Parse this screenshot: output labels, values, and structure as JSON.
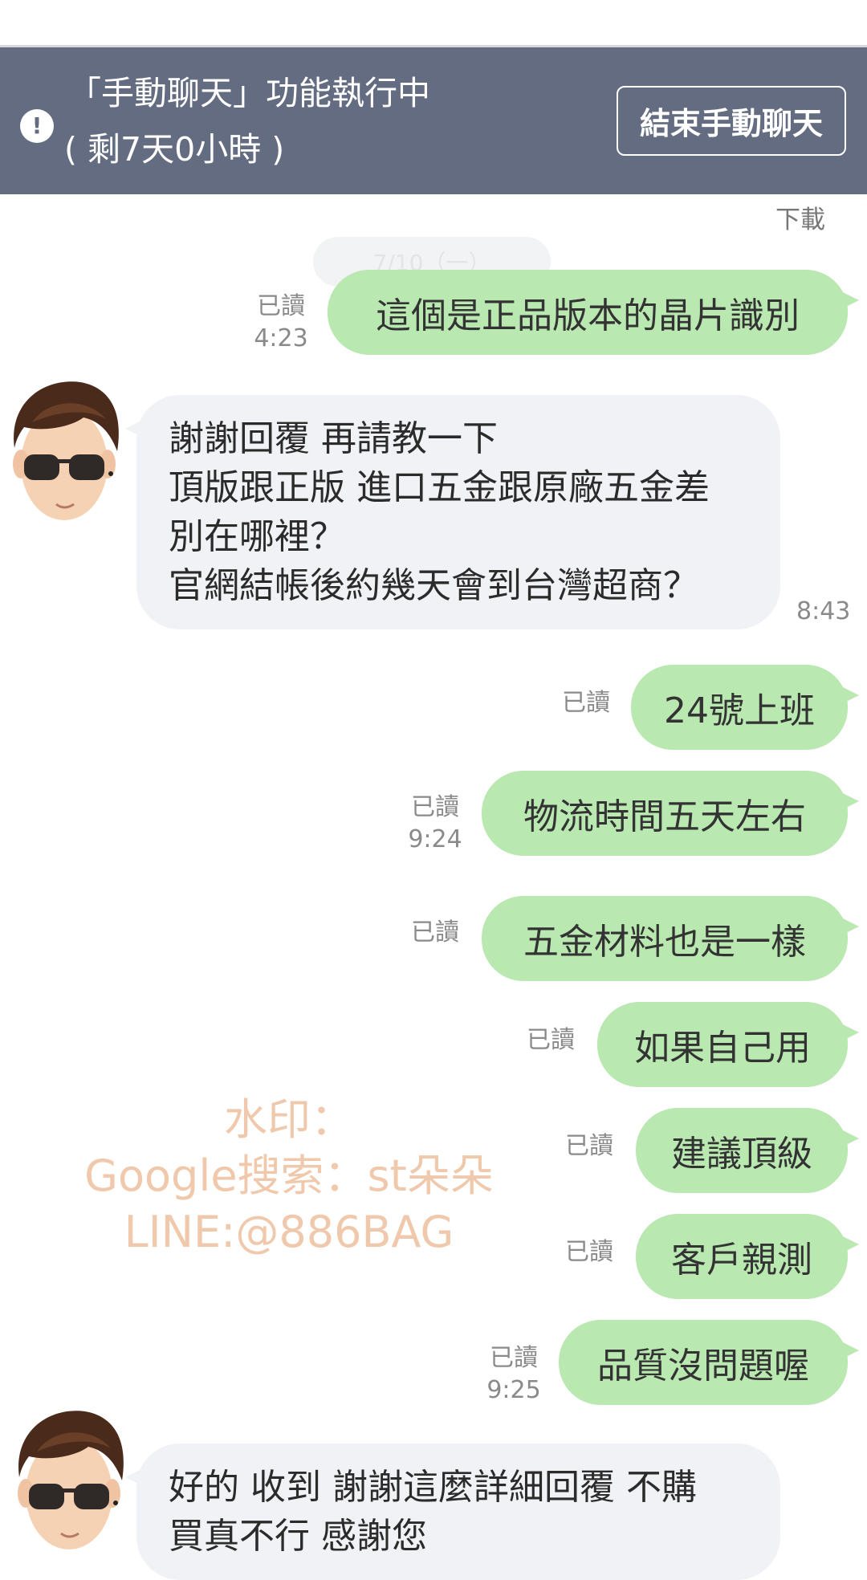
{
  "banner": {
    "alert_glyph": "!",
    "title": "「手動聊天」功能執行中",
    "remaining": "( 剩7天0小時 )",
    "end_button": "結束手動聊天"
  },
  "download_label": "下載",
  "date_separator": "7/10（一）",
  "messages": [
    {
      "side": "out",
      "text": "這個是正品版本的晶片識別",
      "read": "已讀",
      "time": "4:23"
    },
    {
      "side": "in",
      "lines": [
        "謝謝回覆  再請教一下",
        "頂版跟正版 進口五金跟原廠五金差",
        "別在哪裡？",
        "官網結帳後約幾天會到台灣超商？"
      ],
      "time": "8:43"
    },
    {
      "side": "out",
      "text": "24號上班",
      "read": "已讀"
    },
    {
      "side": "out",
      "text": "物流時間五天左右",
      "read": "已讀",
      "time": "9:24"
    },
    {
      "side": "out",
      "text": "五金材料也是一樣",
      "read": "已讀"
    },
    {
      "side": "out",
      "text": "如果自己用",
      "read": "已讀"
    },
    {
      "side": "out",
      "text": "建議頂級",
      "read": "已讀"
    },
    {
      "side": "out",
      "text": "客戶親測",
      "read": "已讀"
    },
    {
      "side": "out",
      "text": "品質沒問題喔",
      "read": "已讀",
      "time": "9:25"
    },
    {
      "side": "in",
      "lines": [
        "好的 收到 謝謝這麼詳細回覆 不購",
        "買真不行 感謝您"
      ]
    }
  ],
  "watermark": {
    "line1": "水印：",
    "line2": "Google搜索：st朵朵",
    "line3": "LINE:@886BAG"
  },
  "colors": {
    "banner": "#646c81",
    "outgoing_bubble": "#b9e8b1",
    "incoming_bubble": "#f1f2f5",
    "watermark": "#efc3a2"
  }
}
